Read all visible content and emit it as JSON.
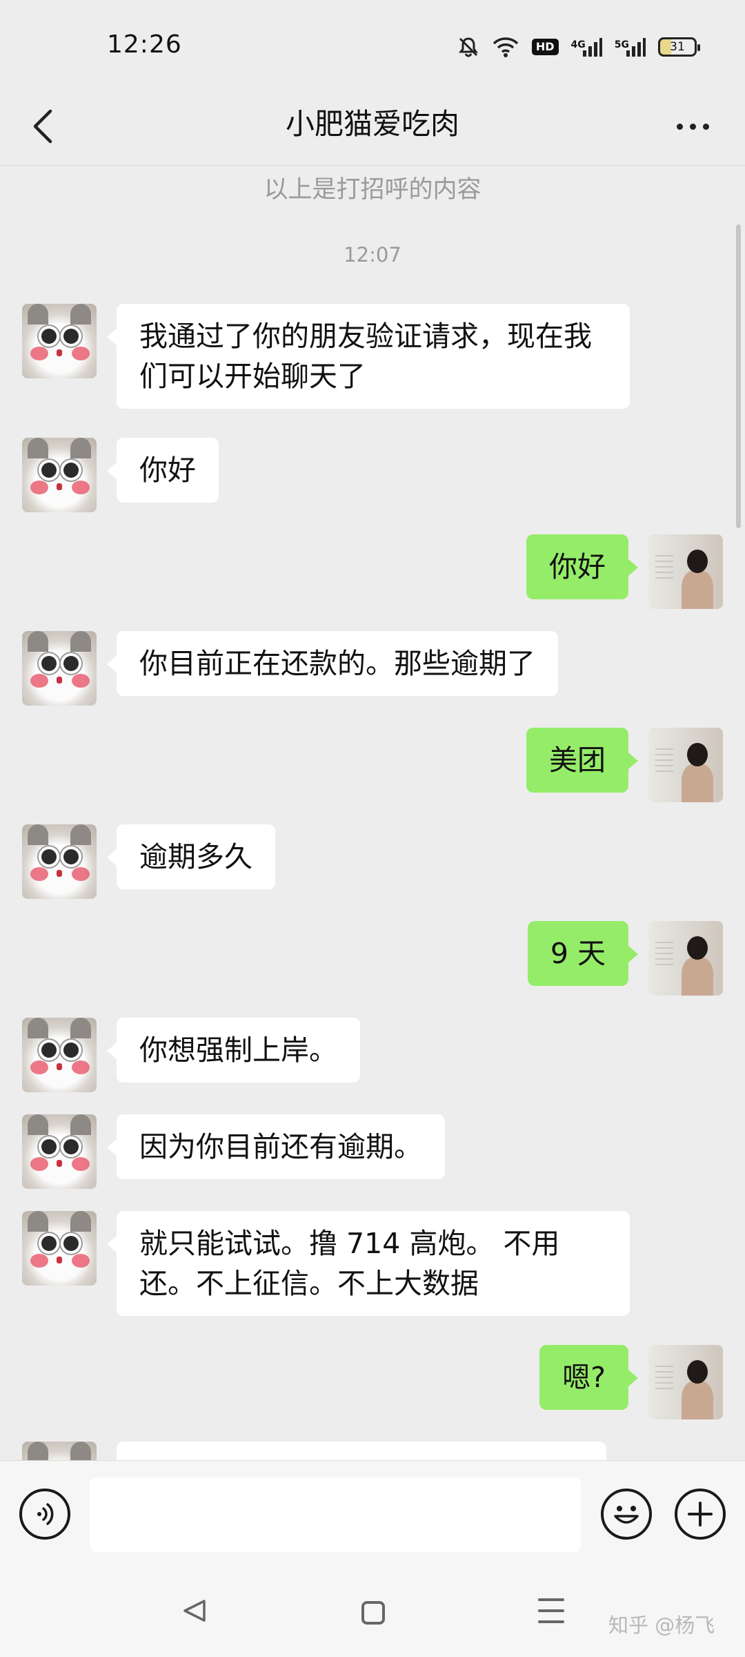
{
  "status_bar": {
    "time": "12:26",
    "network_4g": "4G",
    "network_5g": "5G",
    "hd": "HD",
    "battery": "31",
    "icons": [
      "mute-bell-icon",
      "wifi-icon",
      "hd-icon",
      "signal-4g-icon",
      "signal-5g-icon",
      "battery-icon"
    ]
  },
  "header": {
    "title": "小肥猫爱吃肉",
    "icons": [
      "back-chevron-icon",
      "more-dots-icon"
    ]
  },
  "chat": {
    "greeting_note": "以上是打招呼的内容",
    "timestamp": "12:07",
    "messages": [
      {
        "from": "them",
        "text": "我通过了你的朋友验证请求，现在我们可以开始聊天了"
      },
      {
        "from": "them",
        "text": "你好"
      },
      {
        "from": "me",
        "text": "你好"
      },
      {
        "from": "them",
        "text": "你目前正在还款的。那些逾期了"
      },
      {
        "from": "me",
        "text": "美团"
      },
      {
        "from": "them",
        "text": "逾期多久"
      },
      {
        "from": "me",
        "text": "9 天"
      },
      {
        "from": "them",
        "text": "你想强制上岸。"
      },
      {
        "from": "them",
        "text": "因为你目前还有逾期。"
      },
      {
        "from": "them",
        "text": "就只能试试。撸 714 高炮。 不用还。不上征信。不上大数据"
      },
      {
        "from": "me",
        "text": "嗯?"
      },
      {
        "from": "them",
        "text": ""
      }
    ]
  },
  "input_bar": {
    "placeholder": "",
    "value": "",
    "icons": [
      "voice-icon",
      "emoji-icon",
      "plus-icon"
    ]
  },
  "nav_bar": {
    "watermark": "知乎 @杨飞",
    "icons": [
      "nav-back-icon",
      "nav-home-icon",
      "nav-menu-icon"
    ]
  },
  "colors": {
    "background": "#ededed",
    "incoming_bubble": "#ffffff",
    "outgoing_bubble": "#95ec69",
    "muted_text": "#9a9a9a"
  }
}
